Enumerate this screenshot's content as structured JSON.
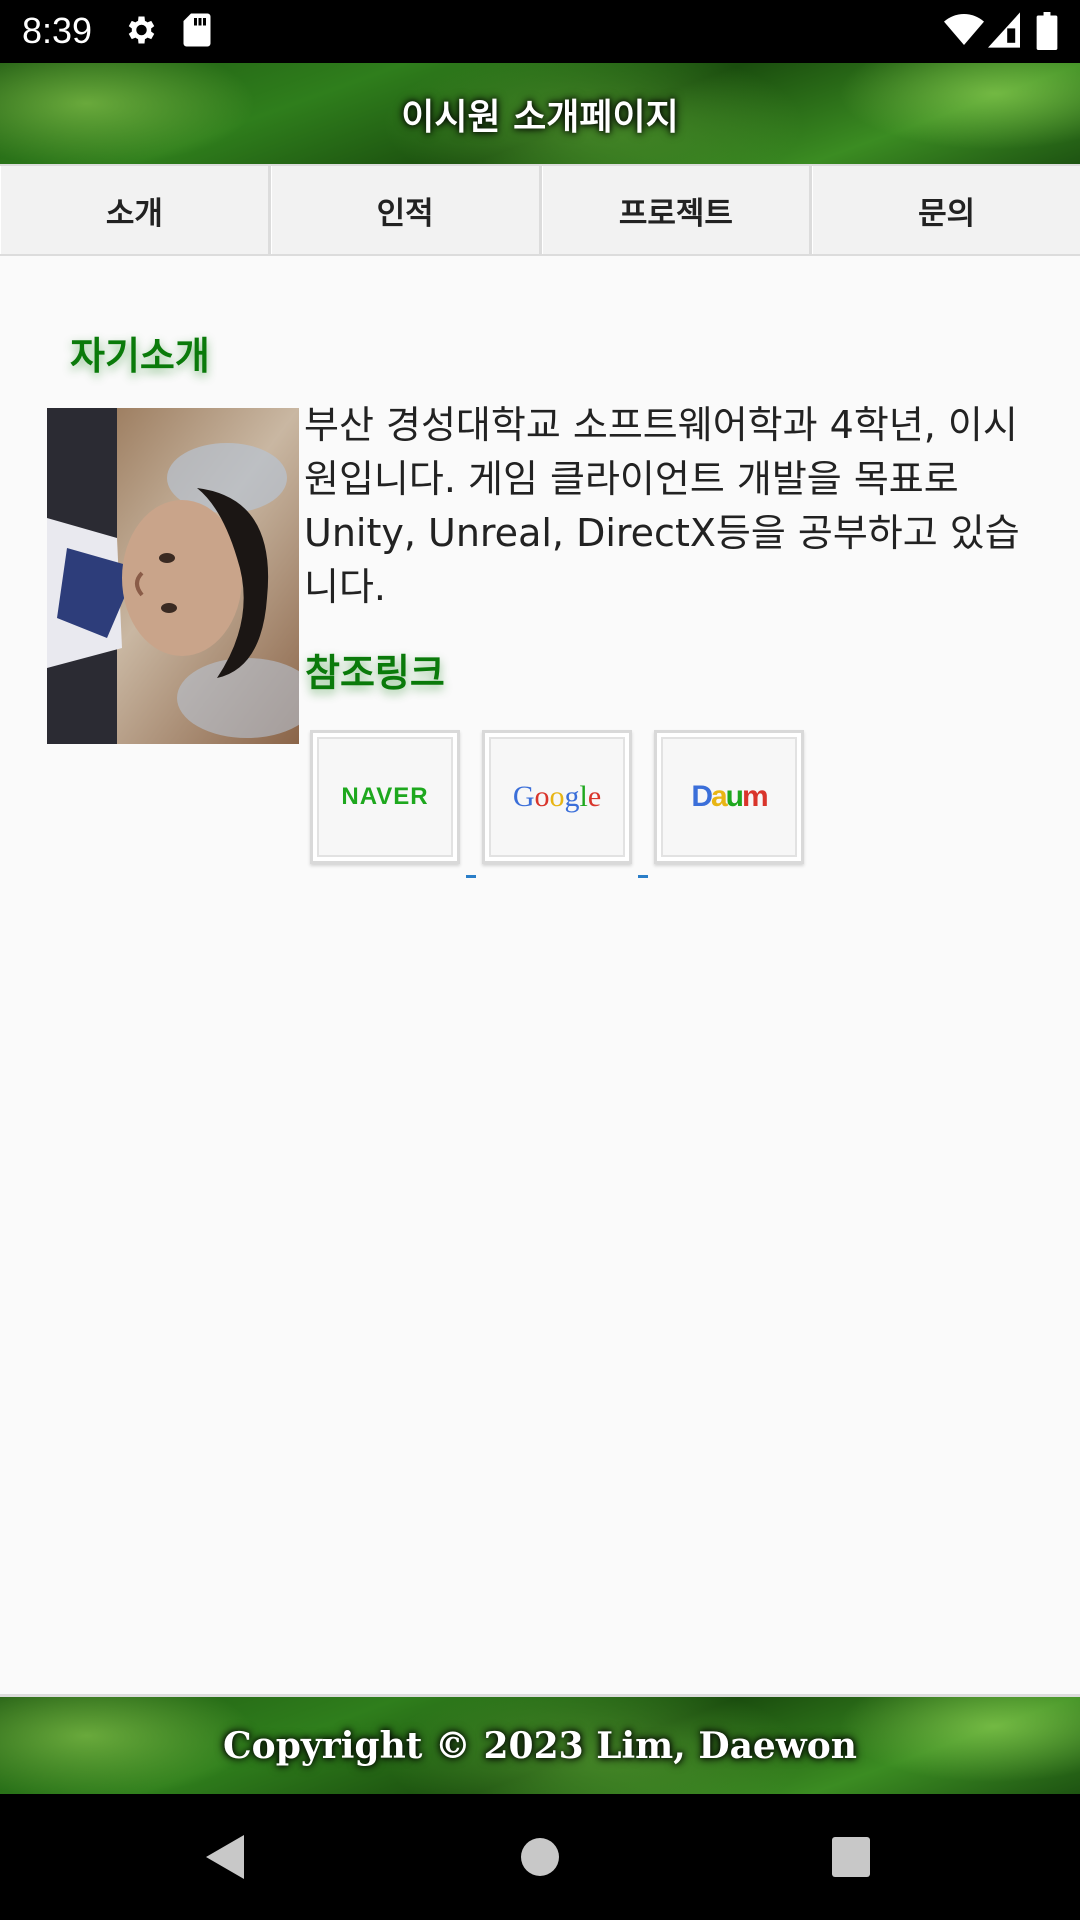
{
  "status_bar": {
    "time": "8:39",
    "icons": [
      "gear-icon",
      "sd-card-icon",
      "wifi-icon",
      "signal-icon",
      "battery-icon"
    ]
  },
  "header": {
    "title": "이시원 소개페이지"
  },
  "tabs": [
    {
      "label": "소개"
    },
    {
      "label": "인적"
    },
    {
      "label": "프로젝트"
    },
    {
      "label": "문의"
    }
  ],
  "intro": {
    "heading": "자기소개",
    "bio": "부산 경성대학교 소프트웨어학과 4학년, 이시원입니다. 게임 클라이언트 개발을 목표로 Unity, Unreal, DirectX등을 공부하고 있습니다."
  },
  "links": {
    "heading": "참조링크",
    "items": [
      {
        "label": "NAVER",
        "color": "#1ea81e"
      },
      {
        "label": "Google"
      },
      {
        "label": "Daum"
      }
    ]
  },
  "footer": {
    "text": "Copyright © 2023 Lim, Daewon"
  },
  "colors": {
    "accent_green": "#0a7a0a",
    "link_blue": "#2a7ec8"
  }
}
